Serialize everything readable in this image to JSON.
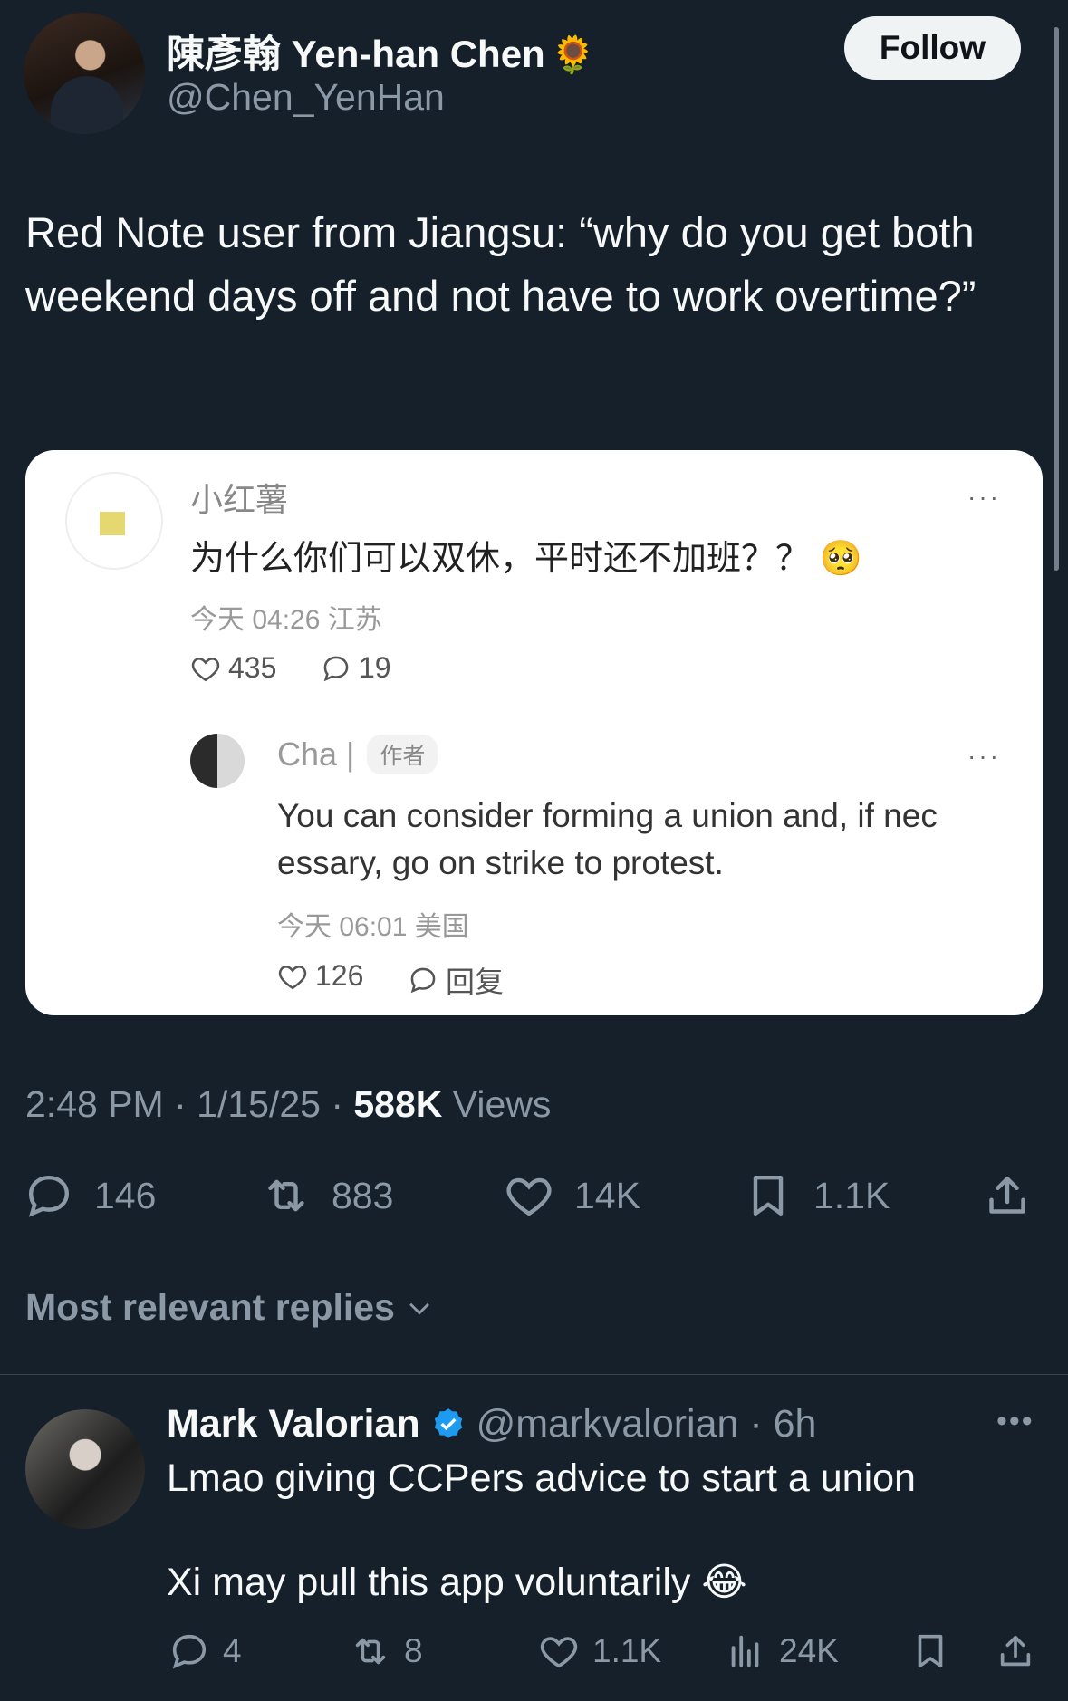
{
  "author": {
    "display_name": "陳彥翰 Yen-han Chen",
    "emoji": "🌻",
    "handle": "@Chen_YenHan",
    "follow_label": "Follow"
  },
  "tweet": {
    "text": "Red Note user from Jiangsu: “why do you get both weekend days off and not have to work overtime?”",
    "time": "2:48 PM",
    "date": "1/15/25",
    "views_count": "588K",
    "views_label": "Views"
  },
  "card": {
    "comment1": {
      "user": "小红薯",
      "text": "为什么你们可以双休，平时还不加班？？",
      "emoji": "🥺",
      "meta": "今天 04:26 江苏",
      "likes": "435",
      "replies": "19",
      "more": "···"
    },
    "comment2": {
      "user": "Cha    |",
      "tag": "作者",
      "text": "You can consider forming a union and, if nec essary, go on strike to protest.",
      "meta": "今天 06:01 美国",
      "likes": "126",
      "reply_label": "回复",
      "more": "···"
    }
  },
  "actions": {
    "replies": "146",
    "reposts": "883",
    "likes": "14K",
    "bookmarks": "1.1K"
  },
  "sort_label": "Most relevant replies",
  "reply": {
    "name": "Mark Valorian",
    "handle_time": "@markvalorian · 6h",
    "more": "•••",
    "text1": "Lmao giving CCPers advice to start a union",
    "text2": "Xi may pull this app voluntarily 😂",
    "replies": "4",
    "reposts": "8",
    "likes": "1.1K",
    "views": "24K"
  },
  "colors": {
    "background": "#15202b",
    "verified": "#1d9bf0",
    "muted": "#8b98a5"
  }
}
